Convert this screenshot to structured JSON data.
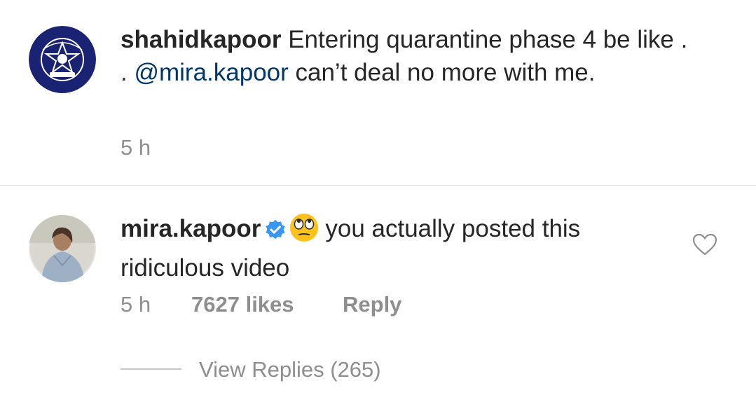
{
  "caption": {
    "username": "shahidkapoor",
    "text_before_mention": " Entering quarantine phase 4 be like . . ",
    "mention": "@mira.kapoor",
    "text_after_mention": " can’t deal no more with me.",
    "timestamp": "5 h"
  },
  "comment": {
    "username": "mira.kapoor",
    "verified": true,
    "emoji": "face-with-rolling-eyes",
    "text": "you actually posted this ridiculous video",
    "timestamp": "5 h",
    "likes": "7627 likes",
    "reply_label": "Reply",
    "view_replies": "View Replies (265)"
  },
  "colors": {
    "mention": "#00376b",
    "meta_gray": "#8e8e8e",
    "verified_blue": "#3897f0",
    "police_badge_navy": "#1a2373"
  }
}
